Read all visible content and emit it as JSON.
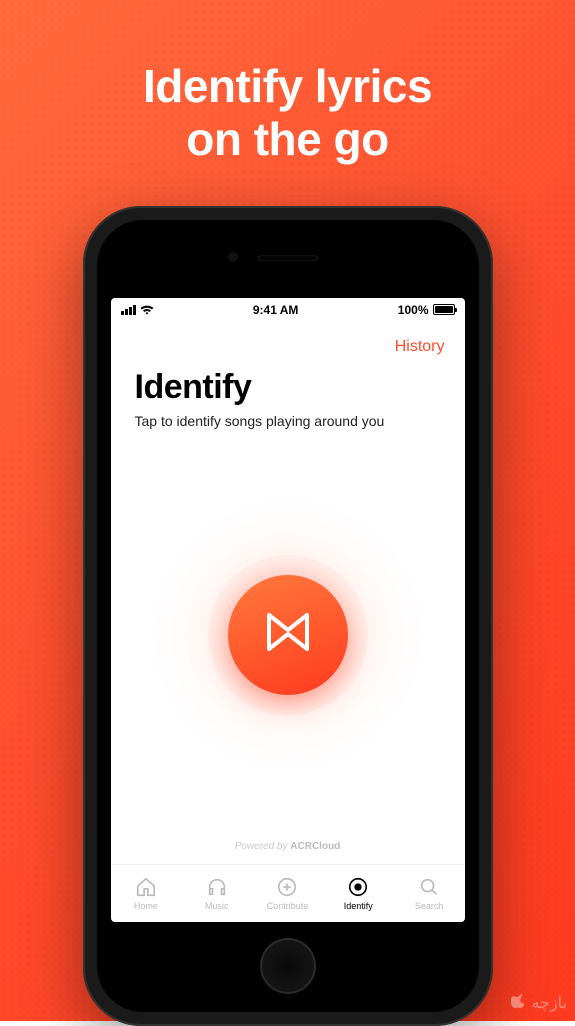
{
  "marketing": {
    "headline_line1": "Identify lyrics",
    "headline_line2": "on the go"
  },
  "status_bar": {
    "time": "9:41 AM",
    "battery": "100%"
  },
  "header": {
    "history_link": "History"
  },
  "screen": {
    "title": "Identify",
    "subtitle": "Tap to identify songs playing around you"
  },
  "powered_by": {
    "prefix": "Powered by ",
    "brand": "ACRCloud"
  },
  "tabs": [
    {
      "label": "Home",
      "icon": "home-icon"
    },
    {
      "label": "Music",
      "icon": "headphones-icon"
    },
    {
      "label": "Contribute",
      "icon": "plus-circle-icon"
    },
    {
      "label": "Identify",
      "icon": "target-icon"
    },
    {
      "label": "Search",
      "icon": "search-icon"
    }
  ],
  "watermark": "بازچه"
}
